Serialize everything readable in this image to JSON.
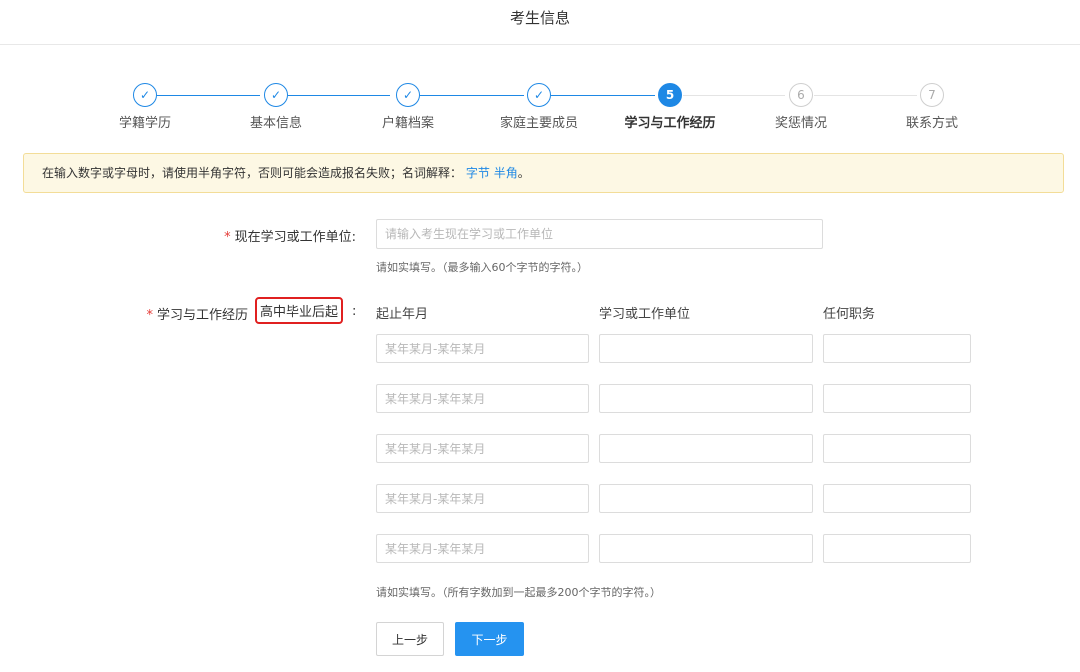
{
  "header": {
    "title": "考生信息"
  },
  "steps": [
    {
      "label": "学籍学历",
      "num": "✓",
      "state": "done"
    },
    {
      "label": "基本信息",
      "num": "✓",
      "state": "done"
    },
    {
      "label": "户籍档案",
      "num": "✓",
      "state": "done"
    },
    {
      "label": "家庭主要成员",
      "num": "✓",
      "state": "done"
    },
    {
      "label": "学习与工作经历",
      "num": "5",
      "state": "active"
    },
    {
      "label": "奖惩情况",
      "num": "6",
      "state": "todo"
    },
    {
      "label": "联系方式",
      "num": "7",
      "state": "todo"
    }
  ],
  "notice": {
    "text": "在输入数字或字母时，请使用半角字符，否则可能会造成报名失败；名词解释：",
    "link1": "字节",
    "link2": "半角",
    "end": "。"
  },
  "form": {
    "required_mark": "*",
    "current_unit_label": "现在学习或工作单位:",
    "current_unit_placeholder": "请输入考生现在学习或工作单位",
    "current_unit_hint": "请如实填写。（最多输入60个字节的字符。）",
    "history_label": "学习与工作经历",
    "history_highlight": "高中毕业后起",
    "history_colon": ":",
    "columns": {
      "period": "起止年月",
      "unit": "学习或工作单位",
      "position": "任何职务"
    },
    "period_placeholder": "某年某月-某年某月",
    "history_hint": "请如实填写。（所有字数加到一起最多200个字节的字符。）",
    "prev_button": "上一步",
    "next_button": "下一步"
  }
}
